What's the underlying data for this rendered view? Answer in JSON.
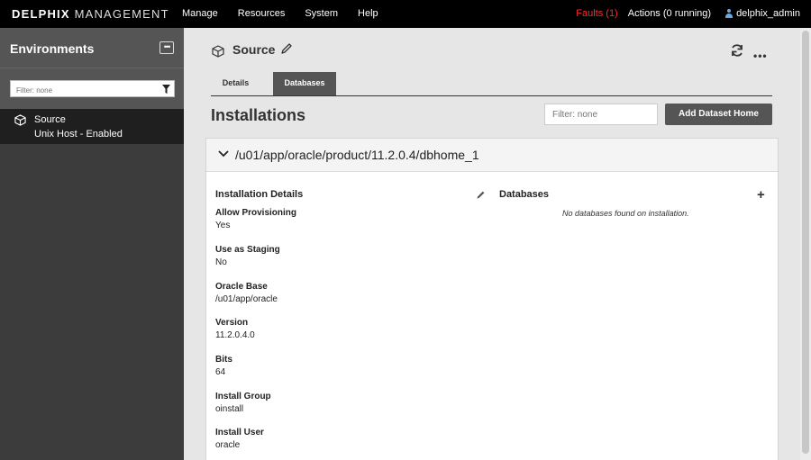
{
  "app": {
    "brand_bold": "DELPHIX",
    "brand_light": "MANAGEMENT"
  },
  "topnav": {
    "items": [
      "Manage",
      "Resources",
      "System",
      "Help"
    ],
    "faults": "Faults (1)",
    "actions": "Actions (0 running)",
    "user": "delphix_admin",
    "faults_color": "#ff2b2b"
  },
  "sidebar": {
    "title": "Environments",
    "more_icon": "more-icon",
    "filter_placeholder": "Filter: none",
    "filter_icon": "filter-icon",
    "items": [
      {
        "name": "Source",
        "subtitle": "Unix Host - Enabled",
        "icon": "cube-icon"
      }
    ]
  },
  "main": {
    "title": "Source",
    "tabs": [
      "Details",
      "Databases"
    ],
    "active_tab": "Databases",
    "section_title": "Installations",
    "filter_placeholder": "Filter: none",
    "add_button": "Add Dataset Home"
  },
  "installation": {
    "path": "/u01/app/oracle/product/11.2.0.4/dbhome_1",
    "details_title": "Installation Details",
    "databases_title": "Databases",
    "no_databases": "No databases found on installation.",
    "fields": [
      {
        "label": "Allow Provisioning",
        "value": "Yes"
      },
      {
        "label": "Use as Staging",
        "value": "No"
      },
      {
        "label": "Oracle Base",
        "value": "/u01/app/oracle"
      },
      {
        "label": "Version",
        "value": "11.2.0.4.0"
      },
      {
        "label": "Bits",
        "value": "64"
      },
      {
        "label": "Install Group",
        "value": "oinstall"
      },
      {
        "label": "Install User",
        "value": "oracle"
      }
    ]
  }
}
